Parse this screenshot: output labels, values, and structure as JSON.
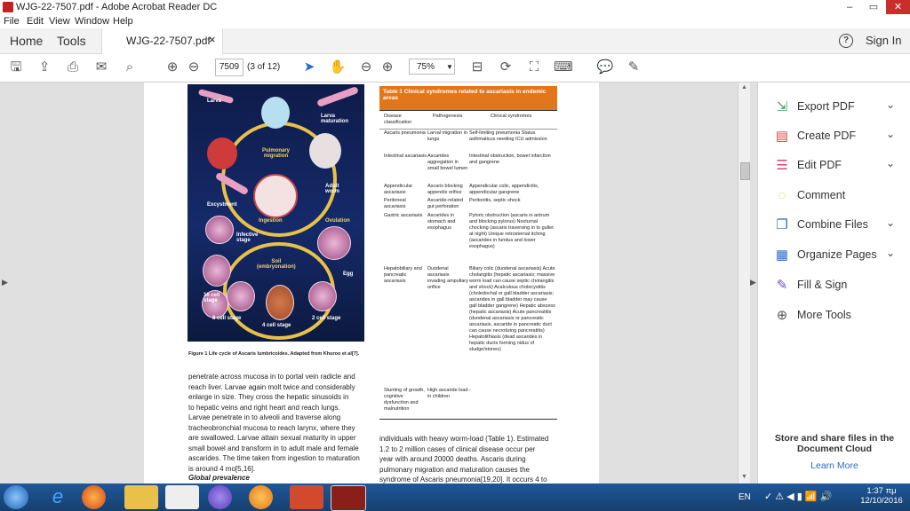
{
  "window": {
    "title": "WJG-22-7507.pdf - Adobe Acrobat Reader DC",
    "minimize": "–",
    "restore": "▭",
    "close": "✕"
  },
  "menu": [
    "File",
    "Edit",
    "View",
    "Window",
    "Help"
  ],
  "nav": {
    "home": "Home",
    "tools": "Tools",
    "tab_title": "WJG-22-7507.pdf",
    "tab_close": "×",
    "help": "?",
    "sign_in": "Sign In"
  },
  "toolbar": {
    "page_number": "7509",
    "page_count": "(3 of 12)",
    "zoom": "75%"
  },
  "figure": {
    "labels": {
      "larva": "Larva",
      "larva_maturation": "Larva\nmaturation",
      "pulmonary_migration": "Pulmonary\nmigration",
      "adult_worm": "Adult\nworm",
      "excystment": "Excystment",
      "ingestion": "Ingestion",
      "ovulation": "Ovulation",
      "infective_stage": "Infective\nstage",
      "soil": "Soil\n(embryonation)",
      "egg": "Egg",
      "sixteen_cell": "16 cell\nstage",
      "eight_cell": "8 cell stage",
      "four_cell": "4 cell stage",
      "two_cell": "2 cell stage"
    },
    "caption": "Figure 1 Life cycle of Ascaris lumbricoides. Adapted from Khuroo et al[7]."
  },
  "left_text": [
    "penetrate across mucosa in to portal vein radicle and",
    "reach liver. Larvae again molt twice and considerably",
    "enlarge in size. They cross the hepatic sinusoids in",
    "to hepatic veins and right heart and reach lungs.",
    "Larvae penetrate in to alveoli and traverse along",
    "tracheobronchial mucosa to reach larynx, where they",
    "are swallowed. Larvae attain sexual maturity in upper",
    "small bowel and transform in to adult male and female",
    "ascarides. The time taken from ingestion to maturation",
    "is around 4 mo[5,16]."
  ],
  "left_heading": "Global prevalence",
  "table": {
    "title": "Table 1  Clinical syndromes related to ascariasis in endemic areas",
    "headers": [
      "Disease classification",
      "Pathogenesis",
      "Clinical syndromes"
    ],
    "rows": [
      [
        "Ascaris pneumonia",
        "Larval migration in lungs",
        "Self-limiting pneumonia Status asthmaticus needing ICU admission"
      ],
      [
        "Intestinal ascariasis",
        "Ascarides aggregation in small bowel lumen",
        "Intestinal obstruction, bowel infarction and gangrene"
      ],
      [
        "Appendicular ascariasis",
        "Ascaris blocking appendix orifice",
        "Appendicular colic, appendicitis, appendicular gangrene"
      ],
      [
        "Peritoneal ascariasis",
        "Ascaride-related gut perforation",
        "Peritonitis, septic shock"
      ],
      [
        "Gastric ascariasis",
        "Ascarides in stomach and esophagus",
        "Pyloric obstruction (ascaris in antrum and blocking pylorus) Nocturnal chocking (ascaris traversing in to gullet at night) Unique retrosternal itching (ascarides in fundus and lower esophagus)"
      ],
      [
        "Hepatobiliary and pancreatic ascariasis",
        "Duodenal ascariasis invading ampullary orifice",
        "Biliary colic (duodenal ascariasis) Acute cholangitis (hepatic ascariasis; massive worm load can cause septic cholangitis and shock) Acalculous cholecystitis (choledochal or gall bladder ascariasis; ascarides in gall bladder may cause gall bladder gangrene) Hepatic abscess (hepatic ascariasis) Acute pancreatitis (duodenal ascariasis or pancreatic ascariasis, ascaride in pancreatic duct can cause necrotizing pancreatitis) Hepatolithiasis (dead ascarides in hepatic ducts forming nidus of sludge/stones)"
      ],
      [
        "Stunting of growth, cognitive dysfunction and malnutrition",
        "High ascaride load in children",
        "-"
      ]
    ]
  },
  "right_text": [
    "individuals with heavy worm-load (Table 1). Estimated",
    "1.2 to 2 million cases of clinical disease occur per",
    "year with around 20000 deaths. Ascaris during",
    "pulmonary migration and maturation causes the",
    "syndrome of Ascaris pneumonia[19,20]. It occurs 4 to"
  ],
  "tools": [
    {
      "label": "Export PDF",
      "icon": "export-pdf-icon",
      "color": "#3aa36a",
      "glyph": "⇲",
      "dropdown": true
    },
    {
      "label": "Create PDF",
      "icon": "create-pdf-icon",
      "color": "#d9463e",
      "glyph": "▤",
      "dropdown": true
    },
    {
      "label": "Edit PDF",
      "icon": "edit-pdf-icon",
      "color": "#d9407a",
      "glyph": "☰",
      "dropdown": true
    },
    {
      "label": "Comment",
      "icon": "comment-icon",
      "color": "#e8b818",
      "glyph": "◌",
      "dropdown": false
    },
    {
      "label": "Combine Files",
      "icon": "combine-files-icon",
      "color": "#2a6bc8",
      "glyph": "❐",
      "dropdown": true
    },
    {
      "label": "Organize Pages",
      "icon": "organize-pages-icon",
      "color": "#2a6bc8",
      "glyph": "▦",
      "dropdown": true
    },
    {
      "label": "Fill & Sign",
      "icon": "fill-sign-icon",
      "color": "#6b4fc8",
      "glyph": "✎",
      "dropdown": false
    },
    {
      "label": "More Tools",
      "icon": "more-tools-icon",
      "color": "#555555",
      "glyph": "⊕",
      "dropdown": false
    }
  ],
  "promo": {
    "text": "Store and share files in the Document Cloud",
    "link": "Learn More"
  },
  "taskbar": {
    "lang": "EN",
    "time": "1:37 πμ",
    "date": "12/10/2016"
  }
}
